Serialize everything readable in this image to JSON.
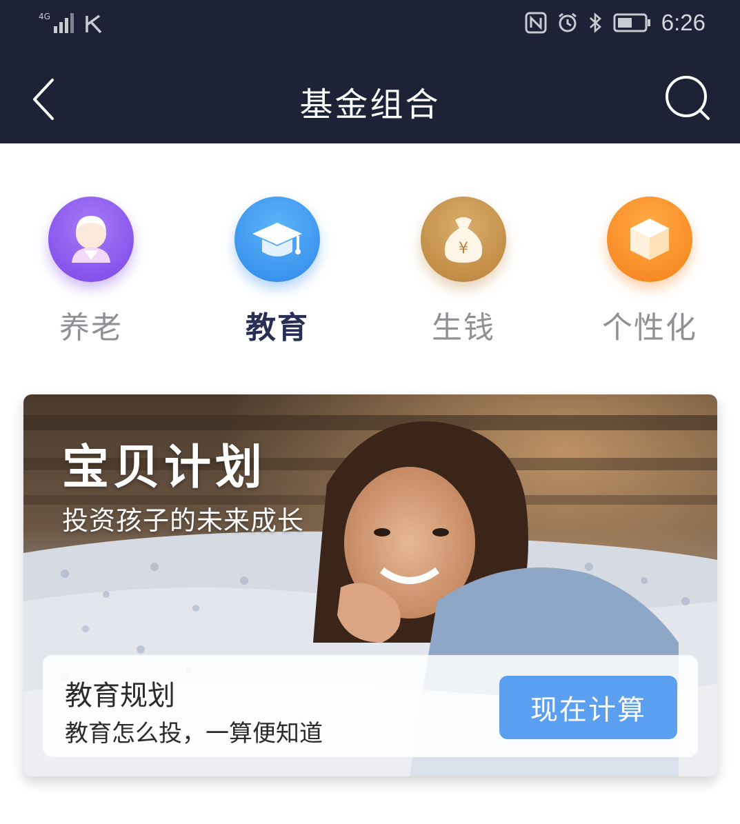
{
  "status": {
    "network": "4G",
    "carrier_icon": "k-app-icon",
    "time": "6:26"
  },
  "nav": {
    "title": "基金组合"
  },
  "categories": [
    {
      "label": "养老",
      "icon": "elderly-person-icon",
      "color": "#8b5cf0",
      "active": false
    },
    {
      "label": "教育",
      "icon": "graduation-cap-icon",
      "color": "#3a96ee",
      "active": true
    },
    {
      "label": "生钱",
      "icon": "money-bag-icon",
      "color": "#c4924a",
      "active": false
    },
    {
      "label": "个性化",
      "icon": "cube-icon",
      "color": "#f88e22",
      "active": false
    }
  ],
  "banner": {
    "title": "宝贝计划",
    "subtitle": "投资孩子的未来成长",
    "plan": {
      "title": "教育规划",
      "description": "教育怎么投，一算便知道",
      "button_label": "现在计算",
      "button_color": "#5a9ff0"
    }
  },
  "colors": {
    "header_bg": "#1e2236",
    "active_label": "#2a2d55",
    "inactive_label": "#8f9196"
  }
}
